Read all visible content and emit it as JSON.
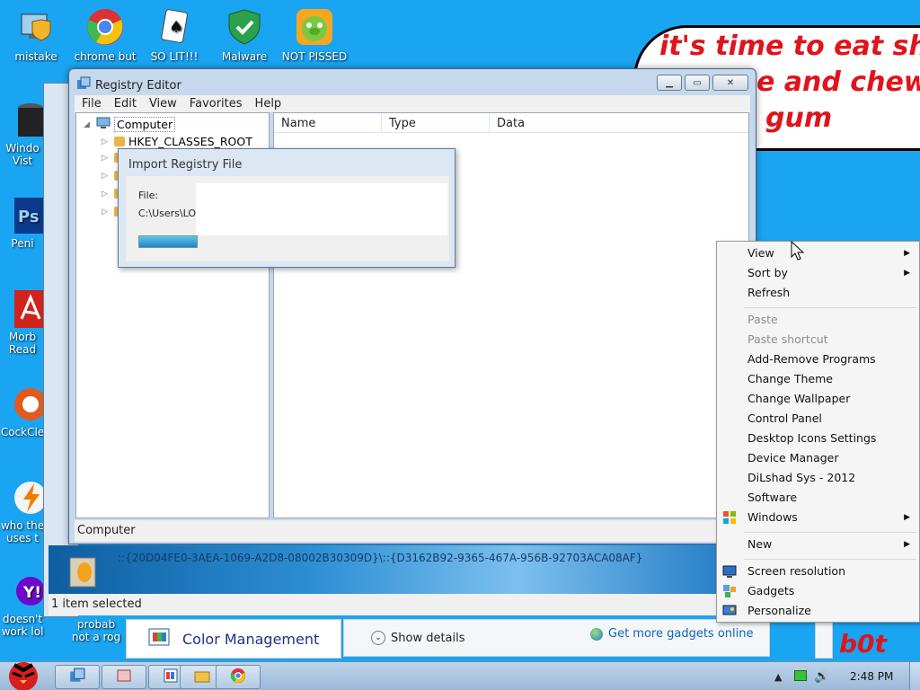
{
  "desktop_icons_top": [
    {
      "label": "mistake",
      "icon": "computer-shield-icon"
    },
    {
      "label": "chrome but",
      "icon": "chrome-icon"
    },
    {
      "label": "SO LIT!!!",
      "icon": "solitaire-icon"
    },
    {
      "label": "Malware",
      "icon": "shield-check-icon"
    },
    {
      "label": "NOT PISSED",
      "icon": "angry-pig-icon"
    }
  ],
  "desktop_icons_left": [
    {
      "label": "Windo",
      "label2": "Vist",
      "icon": "trash-icon"
    },
    {
      "label": "Peni",
      "icon": "photoshop-icon"
    },
    {
      "label": "Morb",
      "label2": "Read",
      "icon": "acrobat-icon"
    },
    {
      "label": "CockCle",
      "icon": "ccleaner-icon"
    },
    {
      "label": "who the",
      "label2": "uses t",
      "icon": "winamp-icon"
    },
    {
      "label": "doesn't",
      "label2": "work lol",
      "icon": "yahoo-icon"
    },
    {
      "label": "probab",
      "label2": "not a rog",
      "icon": "app-icon"
    }
  ],
  "meme": {
    "line1": "it's time to eat shit",
    "line2": "e and chew",
    "line3": "gum",
    "corner": "b0t"
  },
  "registry": {
    "title": "Registry Editor",
    "menu": [
      "File",
      "Edit",
      "View",
      "Favorites",
      "Help"
    ],
    "tree_root": "Computer",
    "tree_child": "HKEY_CLASSES_ROOT",
    "columns": [
      "Name",
      "Type",
      "Data"
    ],
    "status": "Computer"
  },
  "import_dialog": {
    "title": "Import Registry File",
    "file_label": "File:",
    "file_path": "C:\\Users\\LOL"
  },
  "banner": {
    "path": "::{20D04FE0-3AEA-1069-A2D8-08002B30309D}\\::{D3162B92-9365-467A-956B-92703ACA08AF}",
    "status": "1 item selected"
  },
  "control_panel": {
    "title": "Color Management",
    "show_details": "Show details",
    "more_gadgets": "Get more gadgets online"
  },
  "context_menu": {
    "groups": [
      [
        {
          "label": "View",
          "sub": true
        },
        {
          "label": "Sort by",
          "sub": true
        },
        {
          "label": "Refresh"
        }
      ],
      [
        {
          "label": "Paste",
          "disabled": true
        },
        {
          "label": "Paste shortcut",
          "disabled": true
        },
        {
          "label": "Add-Remove Programs"
        },
        {
          "label": "Change Theme"
        },
        {
          "label": "Change Wallpaper"
        },
        {
          "label": "Control Panel"
        },
        {
          "label": "Desktop Icons Settings"
        },
        {
          "label": "Device Manager"
        },
        {
          "label": "DiLshad Sys - 2012"
        },
        {
          "label": "Software"
        },
        {
          "label": "Windows",
          "sub": true,
          "icon": "windows-flag-icon"
        }
      ],
      [
        {
          "label": "New",
          "sub": true
        }
      ],
      [
        {
          "label": "Screen resolution",
          "icon": "monitor-icon"
        },
        {
          "label": "Gadgets",
          "icon": "gadgets-icon"
        },
        {
          "label": "Personalize",
          "icon": "personalize-icon"
        }
      ]
    ]
  },
  "taskbar": {
    "time": "2:48 PM"
  }
}
